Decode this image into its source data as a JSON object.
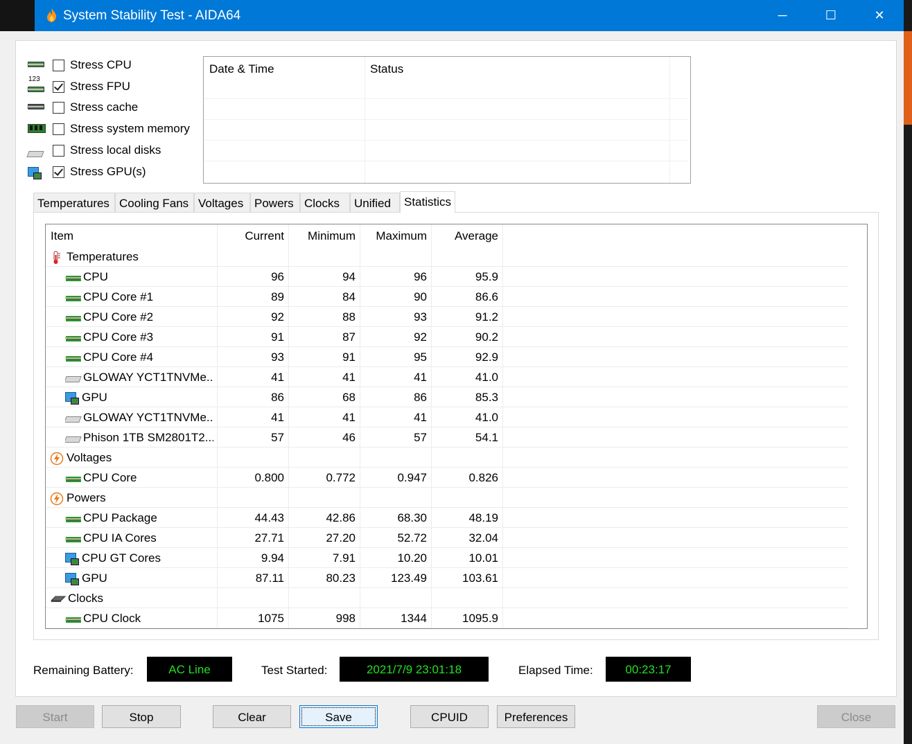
{
  "window": {
    "title": "System Stability Test - AIDA64"
  },
  "titlebar_controls": {
    "minimize": "─",
    "maximize": "☐",
    "close": "✕"
  },
  "stress_options": [
    {
      "label": "Stress CPU",
      "checked": false,
      "icon": "cpu-chip-icon"
    },
    {
      "label": "Stress FPU",
      "checked": true,
      "icon": "fpu-123-icon"
    },
    {
      "label": "Stress cache",
      "checked": false,
      "icon": "cache-chip-icon"
    },
    {
      "label": "Stress system memory",
      "checked": false,
      "icon": "memory-module-icon"
    },
    {
      "label": "Stress local disks",
      "checked": false,
      "icon": "disk-drive-icon"
    },
    {
      "label": "Stress GPU(s)",
      "checked": true,
      "icon": "gpu-monitor-icon"
    }
  ],
  "fpu_icon_text": "123",
  "log": {
    "col_datetime": "Date & Time",
    "col_status": "Status"
  },
  "tabs": [
    {
      "label": "Temperatures",
      "active": false
    },
    {
      "label": "Cooling Fans",
      "active": false
    },
    {
      "label": "Voltages",
      "active": false
    },
    {
      "label": "Powers",
      "active": false
    },
    {
      "label": "Clocks",
      "active": false
    },
    {
      "label": "Unified",
      "active": false
    },
    {
      "label": "Statistics",
      "active": true
    }
  ],
  "stats": {
    "headers": {
      "item": "Item",
      "current": "Current",
      "minimum": "Minimum",
      "maximum": "Maximum",
      "average": "Average"
    },
    "rows": [
      {
        "type": "group",
        "icon": "thermometer-icon",
        "item": "Temperatures"
      },
      {
        "type": "item",
        "icon": "chip-icon",
        "item": "CPU",
        "current": "96",
        "minimum": "94",
        "maximum": "96",
        "average": "95.9"
      },
      {
        "type": "item",
        "icon": "chip-icon",
        "item": "CPU Core #1",
        "current": "89",
        "minimum": "84",
        "maximum": "90",
        "average": "86.6"
      },
      {
        "type": "item",
        "icon": "chip-icon",
        "item": "CPU Core #2",
        "current": "92",
        "minimum": "88",
        "maximum": "93",
        "average": "91.2"
      },
      {
        "type": "item",
        "icon": "chip-icon",
        "item": "CPU Core #3",
        "current": "91",
        "minimum": "87",
        "maximum": "92",
        "average": "90.2"
      },
      {
        "type": "item",
        "icon": "chip-icon",
        "item": "CPU Core #4",
        "current": "93",
        "minimum": "91",
        "maximum": "95",
        "average": "92.9"
      },
      {
        "type": "item",
        "icon": "disk-icon",
        "item": "GLOWAY YCT1TNVMe...",
        "current": "41",
        "minimum": "41",
        "maximum": "41",
        "average": "41.0"
      },
      {
        "type": "item",
        "icon": "gpu-icon",
        "item": "GPU",
        "current": "86",
        "minimum": "68",
        "maximum": "86",
        "average": "85.3"
      },
      {
        "type": "item",
        "icon": "disk-icon",
        "item": "GLOWAY YCT1TNVMe...",
        "current": "41",
        "minimum": "41",
        "maximum": "41",
        "average": "41.0"
      },
      {
        "type": "item",
        "icon": "disk-icon",
        "item": "Phison 1TB SM2801T2...",
        "current": "57",
        "minimum": "46",
        "maximum": "57",
        "average": "54.1"
      },
      {
        "type": "group",
        "icon": "lightning-icon",
        "item": "Voltages"
      },
      {
        "type": "item",
        "icon": "chip-icon",
        "item": "CPU Core",
        "current": "0.800",
        "minimum": "0.772",
        "maximum": "0.947",
        "average": "0.826"
      },
      {
        "type": "group",
        "icon": "lightning-icon",
        "item": "Powers"
      },
      {
        "type": "item",
        "icon": "chip-icon",
        "item": "CPU Package",
        "current": "44.43",
        "minimum": "42.86",
        "maximum": "68.30",
        "average": "48.19"
      },
      {
        "type": "item",
        "icon": "chip-icon",
        "item": "CPU IA Cores",
        "current": "27.71",
        "minimum": "27.20",
        "maximum": "52.72",
        "average": "32.04"
      },
      {
        "type": "item",
        "icon": "gpu-icon",
        "item": "CPU GT Cores",
        "current": "9.94",
        "minimum": "7.91",
        "maximum": "10.20",
        "average": "10.01"
      },
      {
        "type": "item",
        "icon": "gpu-icon",
        "item": "GPU",
        "current": "87.11",
        "minimum": "80.23",
        "maximum": "123.49",
        "average": "103.61"
      },
      {
        "type": "group",
        "icon": "clock-chip-icon",
        "item": "Clocks"
      },
      {
        "type": "item",
        "icon": "chip-icon",
        "item": "CPU Clock",
        "current": "1075",
        "minimum": "998",
        "maximum": "1344",
        "average": "1095.9"
      }
    ]
  },
  "status": {
    "battery_label": "Remaining Battery:",
    "battery_value": "AC Line",
    "started_label": "Test Started:",
    "started_value": "2021/7/9 23:01:18",
    "elapsed_label": "Elapsed Time:",
    "elapsed_value": "00:23:17"
  },
  "buttons": {
    "start": "Start",
    "stop": "Stop",
    "clear": "Clear",
    "save": "Save",
    "cpuid": "CPUID",
    "preferences": "Preferences",
    "close": "Close"
  },
  "colors": {
    "titlebar": "#0078d7",
    "status_text": "#21e021",
    "status_bg": "#000000"
  }
}
